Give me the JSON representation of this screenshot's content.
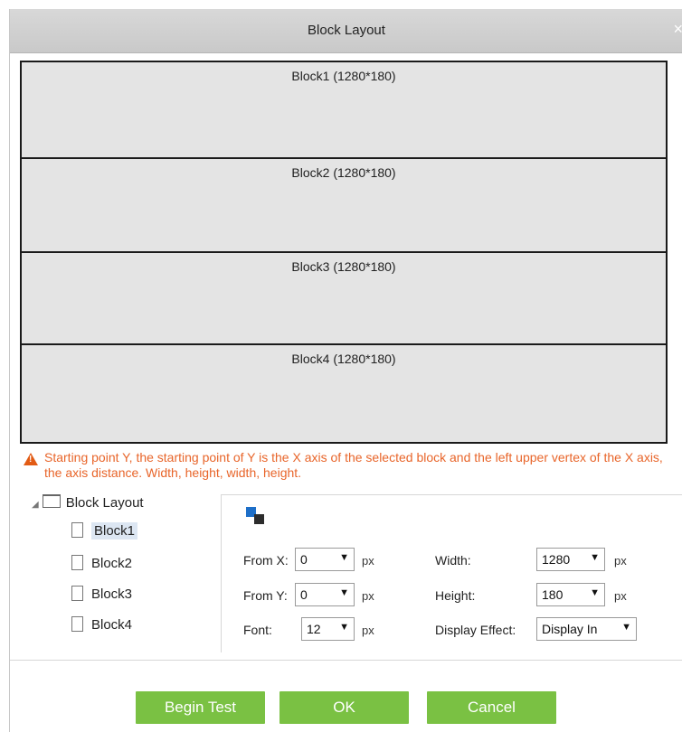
{
  "dialog": {
    "title": "Block Layout",
    "close_glyph": "×"
  },
  "blocks": [
    {
      "label": "Block1 (1280*180)"
    },
    {
      "label": "Block2 (1280*180)"
    },
    {
      "label": "Block3 (1280*180)"
    },
    {
      "label": "Block4 (1280*180)"
    }
  ],
  "warning": {
    "icon": "warning-icon",
    "text": "Starting point Y, the starting point of Y is the X axis of the selected block and the left upper vertex of the X axis, the axis distance. Width, height, width, height."
  },
  "tree": {
    "root_label": "Block Layout",
    "items": [
      {
        "label": "Block1",
        "selected": true
      },
      {
        "label": "Block2"
      },
      {
        "label": "Block3"
      },
      {
        "label": "Block4"
      }
    ]
  },
  "form": {
    "from_x": {
      "label": "From X:",
      "value": "0",
      "unit": "px"
    },
    "from_y": {
      "label": "From Y:",
      "value": "0",
      "unit": "px"
    },
    "font": {
      "label": "Font:",
      "value": "12",
      "unit": "px"
    },
    "width": {
      "label": "Width:",
      "value": "1280",
      "unit": "px"
    },
    "height": {
      "label": "Height:",
      "value": "180",
      "unit": "px"
    },
    "display_effect": {
      "label": "Display Effect:",
      "value": "Display In"
    }
  },
  "buttons": {
    "begin_test": "Begin Test",
    "ok": "OK",
    "cancel": "Cancel"
  },
  "colors": {
    "button_green": "#7ac143",
    "warning_orange": "#e8652a",
    "titlebar": "#cfcfcf"
  }
}
